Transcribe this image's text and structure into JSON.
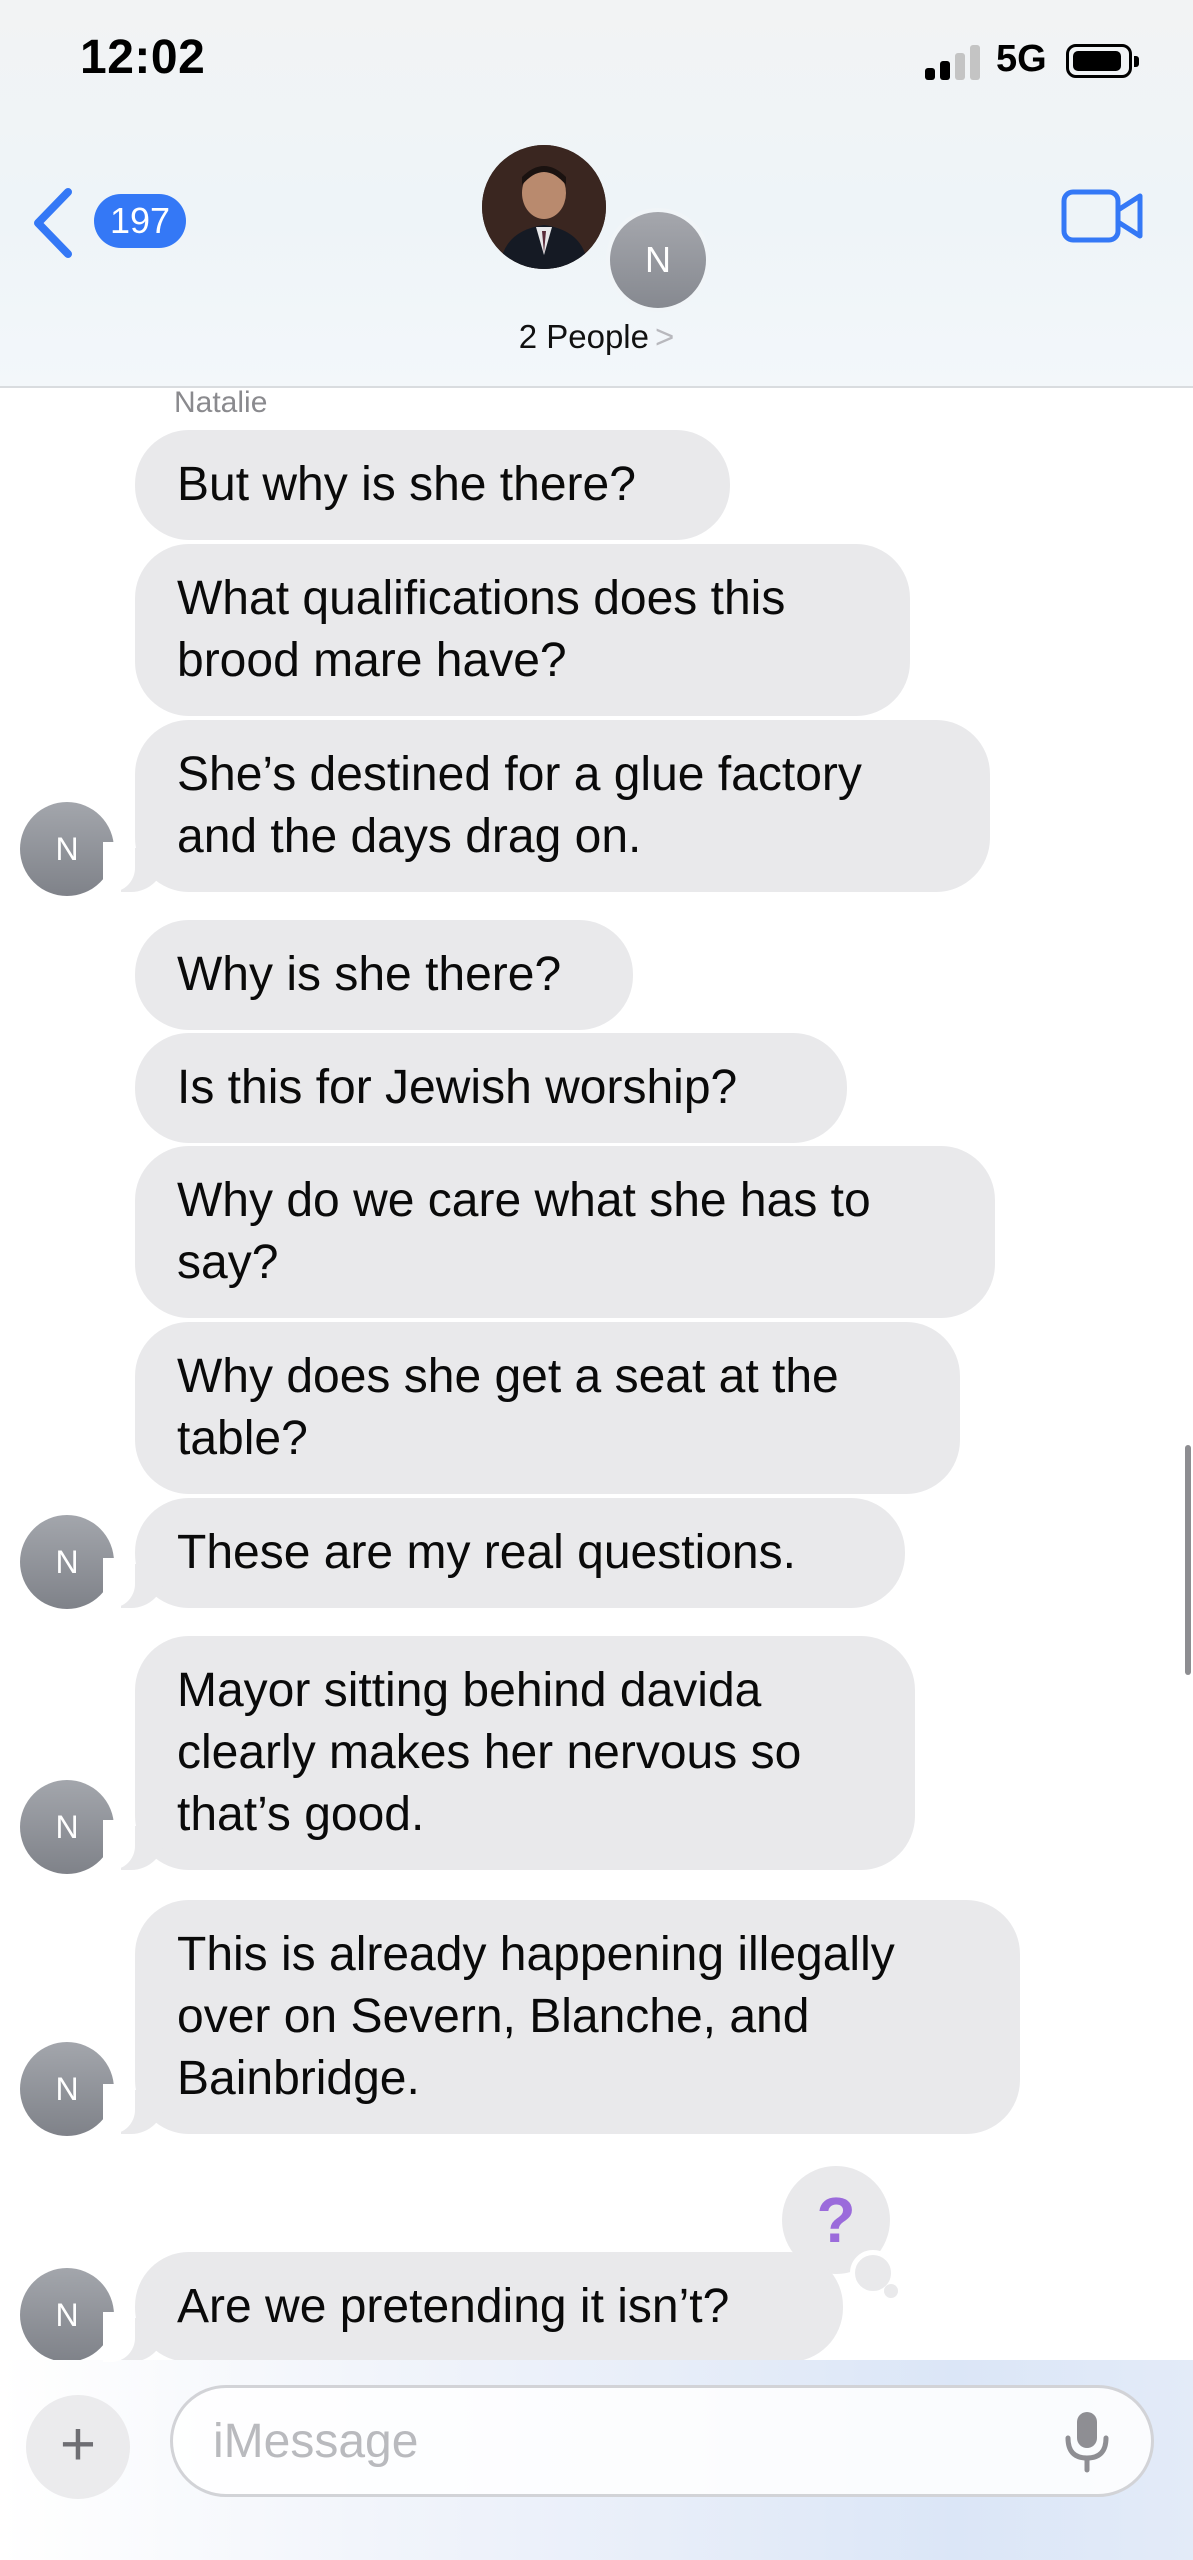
{
  "status_bar": {
    "time": "12:02",
    "network": "5G"
  },
  "header": {
    "back_count": "197",
    "group_avatar_letter": "N",
    "group_name": "2 People",
    "group_name_chevron": ">"
  },
  "conversation": {
    "sender_name": "Natalie",
    "contact_initial": "N",
    "messages": [
      "But why is she there?",
      "What qualifications does this brood mare have?",
      "She’s destined for a glue factory and the days drag on.",
      "Why is she there?",
      "Is this for Jewish worship?",
      "Why do we care what she has to say?",
      "Why does she get a seat at the table?",
      "These are my real questions.",
      "Mayor sitting behind davida clearly makes her nervous so that’s good.",
      "This is already happening illegally over on Severn, Blanche, and Bainbridge.",
      "Are we pretending it isn’t?"
    ],
    "tapback_symbol": "?"
  },
  "composer": {
    "plus_symbol": "+",
    "placeholder": "iMessage",
    "value": ""
  },
  "icons": {
    "back": "chevron-left-icon",
    "facetime": "video-camera-icon",
    "mic": "microphone-icon",
    "plus": "plus-icon",
    "tapback": "question-mark-icon"
  },
  "colors": {
    "accent": "#3478f6",
    "bubble_received": "#e9e9eb",
    "avatar": "#8e9096",
    "tapback": "#9b6bdb"
  }
}
